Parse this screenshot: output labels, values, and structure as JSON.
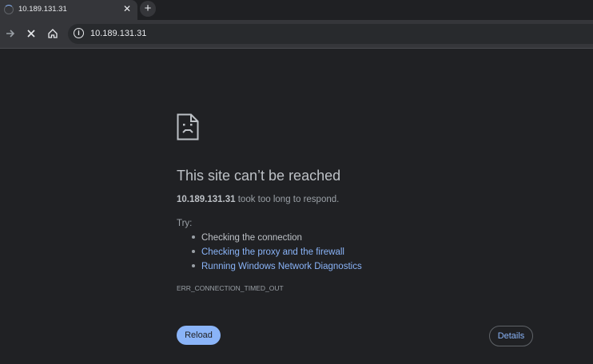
{
  "tab": {
    "title": "10.189.131.31",
    "close_glyph": "✕"
  },
  "newtab": {
    "glyph": "+"
  },
  "toolbar": {
    "url": "10.189.131.31"
  },
  "error": {
    "heading": "This site can’t be reached",
    "host": "10.189.131.31",
    "message_suffix": " took too long to respond.",
    "try_label": "Try:",
    "suggestions": [
      {
        "text": "Checking the connection",
        "is_link": false
      },
      {
        "text": "Checking the proxy and the firewall",
        "is_link": true
      },
      {
        "text": "Running Windows Network Diagnostics",
        "is_link": true
      }
    ],
    "code": "ERR_CONNECTION_TIMED_OUT"
  },
  "buttons": {
    "reload": "Reload",
    "details": "Details"
  },
  "colors": {
    "background": "#202124",
    "link": "#8ab4f8",
    "primary_button": "#8ab4f8"
  },
  "icons": [
    "loading-spinner-icon",
    "close-icon",
    "plus-icon",
    "forward-arrow-icon",
    "stop-icon",
    "home-icon",
    "info-icon",
    "sad-page-icon"
  ]
}
